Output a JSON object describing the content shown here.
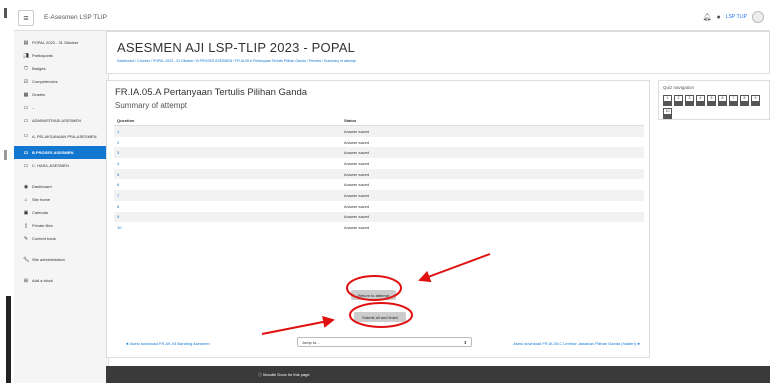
{
  "navbar": {
    "site_name": "E-Asesmen LSP TLIP",
    "menu_icon": "hamburger-icon",
    "user_name": "LSP TLIP"
  },
  "sidebar": {
    "items": [
      {
        "label": "POPAL 2023 - 31 Oktober",
        "icon": "course-icon",
        "active": false
      },
      {
        "label": "Participants",
        "icon": "users-icon",
        "active": false
      },
      {
        "label": "Badges",
        "icon": "badge-icon",
        "active": false
      },
      {
        "label": "Competencies",
        "icon": "check-icon",
        "active": false
      },
      {
        "label": "Grades",
        "icon": "table-icon",
        "active": false
      },
      {
        "label": "...",
        "icon": "folder-icon",
        "active": false
      },
      {
        "label": "ADMINISTRASI ASESMEN",
        "icon": "folder-icon",
        "active": false
      },
      {
        "label": "A. PELAKSANAAN PRA-ASESMEN",
        "icon": "folder-icon",
        "active": false
      },
      {
        "label": "B.PROSES ASESMEN",
        "icon": "folder-icon",
        "active": true
      },
      {
        "label": "C. HASIL ASESMEN",
        "icon": "folder-icon",
        "active": false
      },
      {
        "label": "Dashboard",
        "icon": "dashboard-icon",
        "active": false
      },
      {
        "label": "Site home",
        "icon": "home-icon",
        "active": false
      },
      {
        "label": "Calendar",
        "icon": "calendar-icon",
        "active": false
      },
      {
        "label": "Private files",
        "icon": "file-icon",
        "active": false
      },
      {
        "label": "Content bank",
        "icon": "pencil-icon",
        "active": false
      },
      {
        "label": "Site administration",
        "icon": "wrench-icon",
        "active": false
      },
      {
        "label": "Add a block",
        "icon": "plus-icon",
        "active": false
      }
    ]
  },
  "header": {
    "title": "ASESMEN AJI LSP-TLIP 2023 - POPAL",
    "breadcrumb": "Dashboard / Courses / POPAL 2023 - 31 Oktober / B.PROSES ASESMEN / FR.IA.05.A Pertanyaan Tertulis Pilihan Ganda / Preview / Summary of attempt"
  },
  "summary": {
    "quiz_name": "FR.IA.05.A Pertanyaan Tertulis Pilihan Ganda",
    "subtitle": "Summary of attempt",
    "col_question": "Question",
    "col_status": "Status",
    "rows": [
      {
        "q": "1",
        "status": "Answer saved"
      },
      {
        "q": "2",
        "status": "Answer saved"
      },
      {
        "q": "3",
        "status": "Answer saved"
      },
      {
        "q": "4",
        "status": "Answer saved"
      },
      {
        "q": "5",
        "status": "Answer saved"
      },
      {
        "q": "6",
        "status": "Answer saved"
      },
      {
        "q": "7",
        "status": "Answer saved"
      },
      {
        "q": "8",
        "status": "Answer saved"
      },
      {
        "q": "9",
        "status": "Answer saved"
      },
      {
        "q": "10",
        "status": "Answer saved"
      }
    ],
    "return_button": "Return to attempt",
    "submit_button": "Submit all and finish",
    "prev_link": "◄ Asesi download FR.AK.04 Banding Asesmen",
    "jump_placeholder": "Jump to...",
    "next_link": "Asesi download FR.IA.05.C Lembar Jawaban Pilihan Ganda (hidden) ►"
  },
  "quiz_nav": {
    "title": "Quiz navigation",
    "buttons": [
      "1",
      "2",
      "3",
      "4",
      "5",
      "6",
      "7",
      "8",
      "9",
      "10"
    ]
  },
  "footer": {
    "link": "Moodle Docs for this page",
    "icon": "info-icon"
  },
  "colors": {
    "accent": "#1177d1",
    "annotation": "#e01010",
    "footer_bg": "#3a3a3a"
  }
}
